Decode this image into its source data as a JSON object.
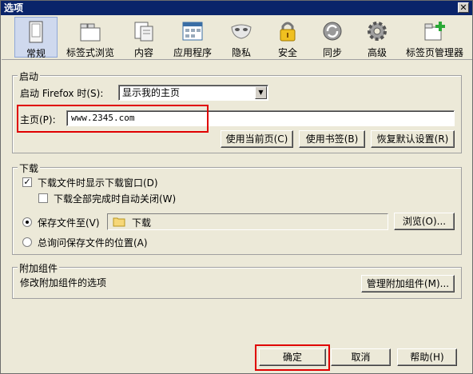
{
  "window": {
    "title": "选项",
    "close_glyph": "✕"
  },
  "toolbar": {
    "items": [
      {
        "label": "常规",
        "icon": "general-icon",
        "selected": true
      },
      {
        "label": "标签式浏览",
        "icon": "tabs-icon"
      },
      {
        "label": "内容",
        "icon": "content-icon"
      },
      {
        "label": "应用程序",
        "icon": "applications-icon"
      },
      {
        "label": "隐私",
        "icon": "privacy-mask-icon"
      },
      {
        "label": "安全",
        "icon": "lock-icon"
      },
      {
        "label": "同步",
        "icon": "sync-icon"
      },
      {
        "label": "高级",
        "icon": "gear-icon"
      },
      {
        "label": "标签页管理器",
        "icon": "tab-manager-icon"
      }
    ]
  },
  "startup": {
    "legend": "启动",
    "when_label": "启动 Firefox 时(S):",
    "when_value": "显示我的主页",
    "homepage_label": "主页(P):",
    "homepage_value": "www.2345.com",
    "use_current_label": "使用当前页(C)",
    "use_bookmark_label": "使用书签(B)",
    "restore_default_label": "恢复默认设置(R)"
  },
  "downloads": {
    "legend": "下载",
    "show_window_label": "下载文件时显示下载窗口(D)",
    "show_window_checked": true,
    "close_when_done_label": "下载全部完成时自动关闭(W)",
    "close_when_done_checked": false,
    "save_to_label": "保存文件至(V)",
    "save_to_selected": true,
    "folder_name": "下载",
    "browse_label": "浏览(O)...",
    "always_ask_label": "总询问保存文件的位置(A)"
  },
  "addons": {
    "legend": "附加组件",
    "description": "修改附加组件的选项",
    "manage_label": "管理附加组件(M)..."
  },
  "footer": {
    "ok_label": "确定",
    "cancel_label": "取消",
    "help_label": "帮助(H)"
  },
  "colors": {
    "highlight_box": "#e00000",
    "title_bar": "#0a246a",
    "selected_tab": "#cfd9ee"
  }
}
